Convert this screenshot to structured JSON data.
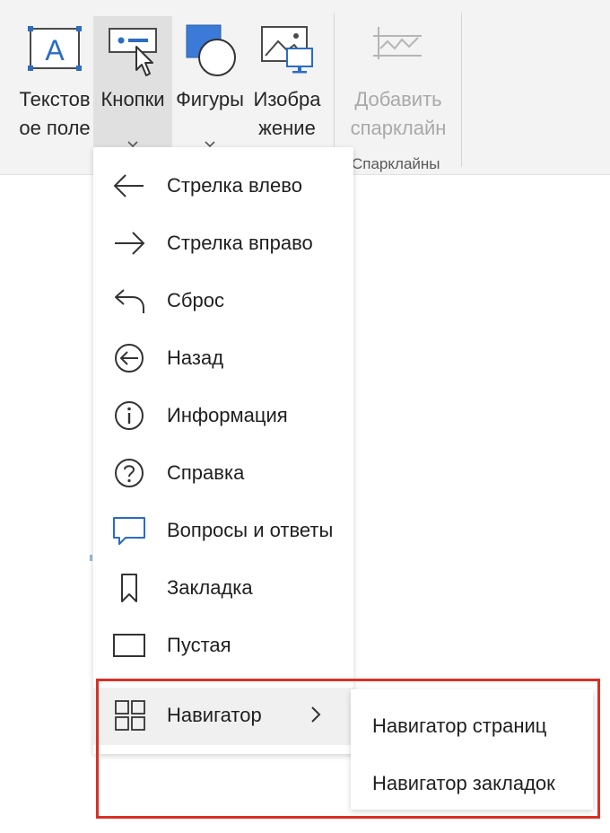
{
  "ribbon": {
    "buttons": [
      {
        "label1": "Текстов",
        "label2": "ое поле",
        "icon": "text-box-icon"
      },
      {
        "label1": "Кнопки",
        "icon": "button-cursor-icon",
        "has_dropdown": true,
        "pressed": true
      },
      {
        "label1": "Фигуры",
        "icon": "shapes-icon",
        "has_dropdown": true
      },
      {
        "label1": "Изобра",
        "label2": "жение",
        "icon": "picture-icon"
      },
      {
        "label1": "Добавить",
        "label2": "спарклайн",
        "icon": "sparkline-icon",
        "disabled": true
      }
    ],
    "group_label": "Спарклайны"
  },
  "menu": {
    "items": [
      {
        "label": "Стрелка влево",
        "icon": "arrow-left-icon"
      },
      {
        "label": "Стрелка вправо",
        "icon": "arrow-right-icon"
      },
      {
        "label": "Сброс",
        "icon": "reset-icon"
      },
      {
        "label": "Назад",
        "icon": "back-circle-icon"
      },
      {
        "label": "Информация",
        "icon": "info-icon"
      },
      {
        "label": "Справка",
        "icon": "help-icon"
      },
      {
        "label": "Вопросы и ответы",
        "icon": "qa-speech-bubble-icon"
      },
      {
        "label": "Закладка",
        "icon": "bookmark-icon"
      },
      {
        "label": "Пустая",
        "icon": "blank-icon"
      },
      {
        "label": "Навигатор",
        "icon": "navigator-grid-icon",
        "has_submenu": true,
        "highlighted": true
      }
    ]
  },
  "submenu": {
    "items": [
      {
        "label": "Навигатор страниц"
      },
      {
        "label": "Навигатор закладок"
      }
    ]
  },
  "colors": {
    "accent_blue": "#2b6cc4",
    "highlight_frame": "#d93025",
    "disabled_text": "#a9a9a9"
  }
}
